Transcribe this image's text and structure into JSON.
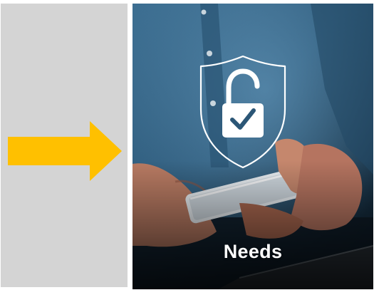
{
  "colors": {
    "left_panel_bg": "#d4d4d4",
    "arrow": "#ffc000",
    "caption": "#ffffff"
  },
  "left_panel": {
    "icon": "right-arrow-icon"
  },
  "right_panel": {
    "image": "hand-holding-smartphone-with-padlock-shield-photo",
    "overlay_icon": "padlock-shield-check-icon",
    "caption": "Needs"
  }
}
